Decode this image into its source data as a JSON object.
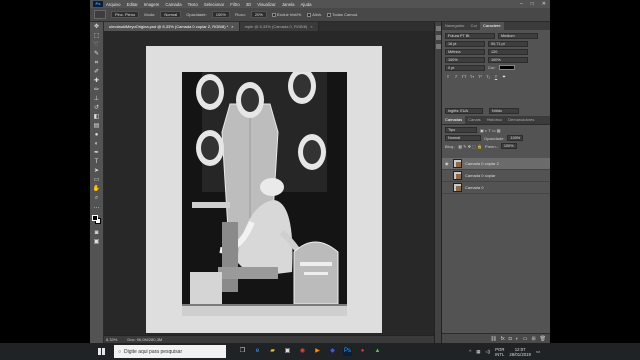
{
  "menu": {
    "app_logo": "Ps",
    "items": [
      "Arquivo",
      "Editar",
      "Imagem",
      "Camada",
      "Texto",
      "Selecionar",
      "Filtro",
      "3D",
      "Visualizar",
      "Janela",
      "Ajuda"
    ],
    "window_controls": [
      "–",
      "□",
      "✕"
    ]
  },
  "options": {
    "preset": "Pinc. Pleno",
    "mode_label": "Modo:",
    "mode_value": "Normal",
    "opacity_label": "Opacidade:",
    "opacity_value": "100%",
    "flow_label": "Fluxo:",
    "flow_value": "20%",
    "erase_history": "Excluir hist/Hi.",
    "align": "Alinh.",
    "sample_all": "Todas Camad."
  },
  "document": {
    "tab_active": "ulmolaukiMeyoOrigina.psd @ 8,33% (Camada 0 copiar 2, RGB/8) *",
    "tab_inactive": "mple @ 8,33% (Camada 0, RGB/8)",
    "zoom": "8,33%",
    "doc_size": "Doc: 96,0M/280,3M"
  },
  "panels": {
    "top_tabs": [
      "Navegador",
      "Cor",
      "Caractere"
    ],
    "character": {
      "font_family": "Futura PT Bt",
      "font_style": "Medium",
      "size": "16 pt",
      "leading": "50,71 pt",
      "kerning": "Métrica",
      "tracking": "120",
      "vscale": "100%",
      "hscale": "100%",
      "baseline": "0 pt",
      "color_label": "Cor:",
      "language": "Inglês: EUA",
      "antialias": "Nítido"
    },
    "layer_tabs": [
      "Camadas",
      "Canais",
      "Histórico",
      "Demarcadores"
    ],
    "kind_label": "Tipo",
    "blend_mode": "Normal",
    "opacity_label": "Opacidade:",
    "opacity_value": "100%",
    "lock_label": "Bloq.:",
    "fill_label": "Preen.:",
    "fill_value": "100%",
    "layers": [
      "Camada 0 copiar 2",
      "Camada 0 copiar",
      "Camada 0"
    ],
    "footer_icons": [
      "link-icon",
      "fx-icon",
      "mask-icon",
      "adjust-icon",
      "folder-icon",
      "new-layer-icon",
      "trash-icon"
    ]
  },
  "taskbar": {
    "search_placeholder": "Digite aqui para pesquisar",
    "lang_top": "POR",
    "lang_bottom": "INTL",
    "time": "12:07",
    "date": "28/01/2019"
  },
  "colors": {
    "ps_dark": "#3a3a3a",
    "ps_panel": "#535353",
    "canvas_bg": "#282828",
    "taskbar": "#1f2326"
  }
}
